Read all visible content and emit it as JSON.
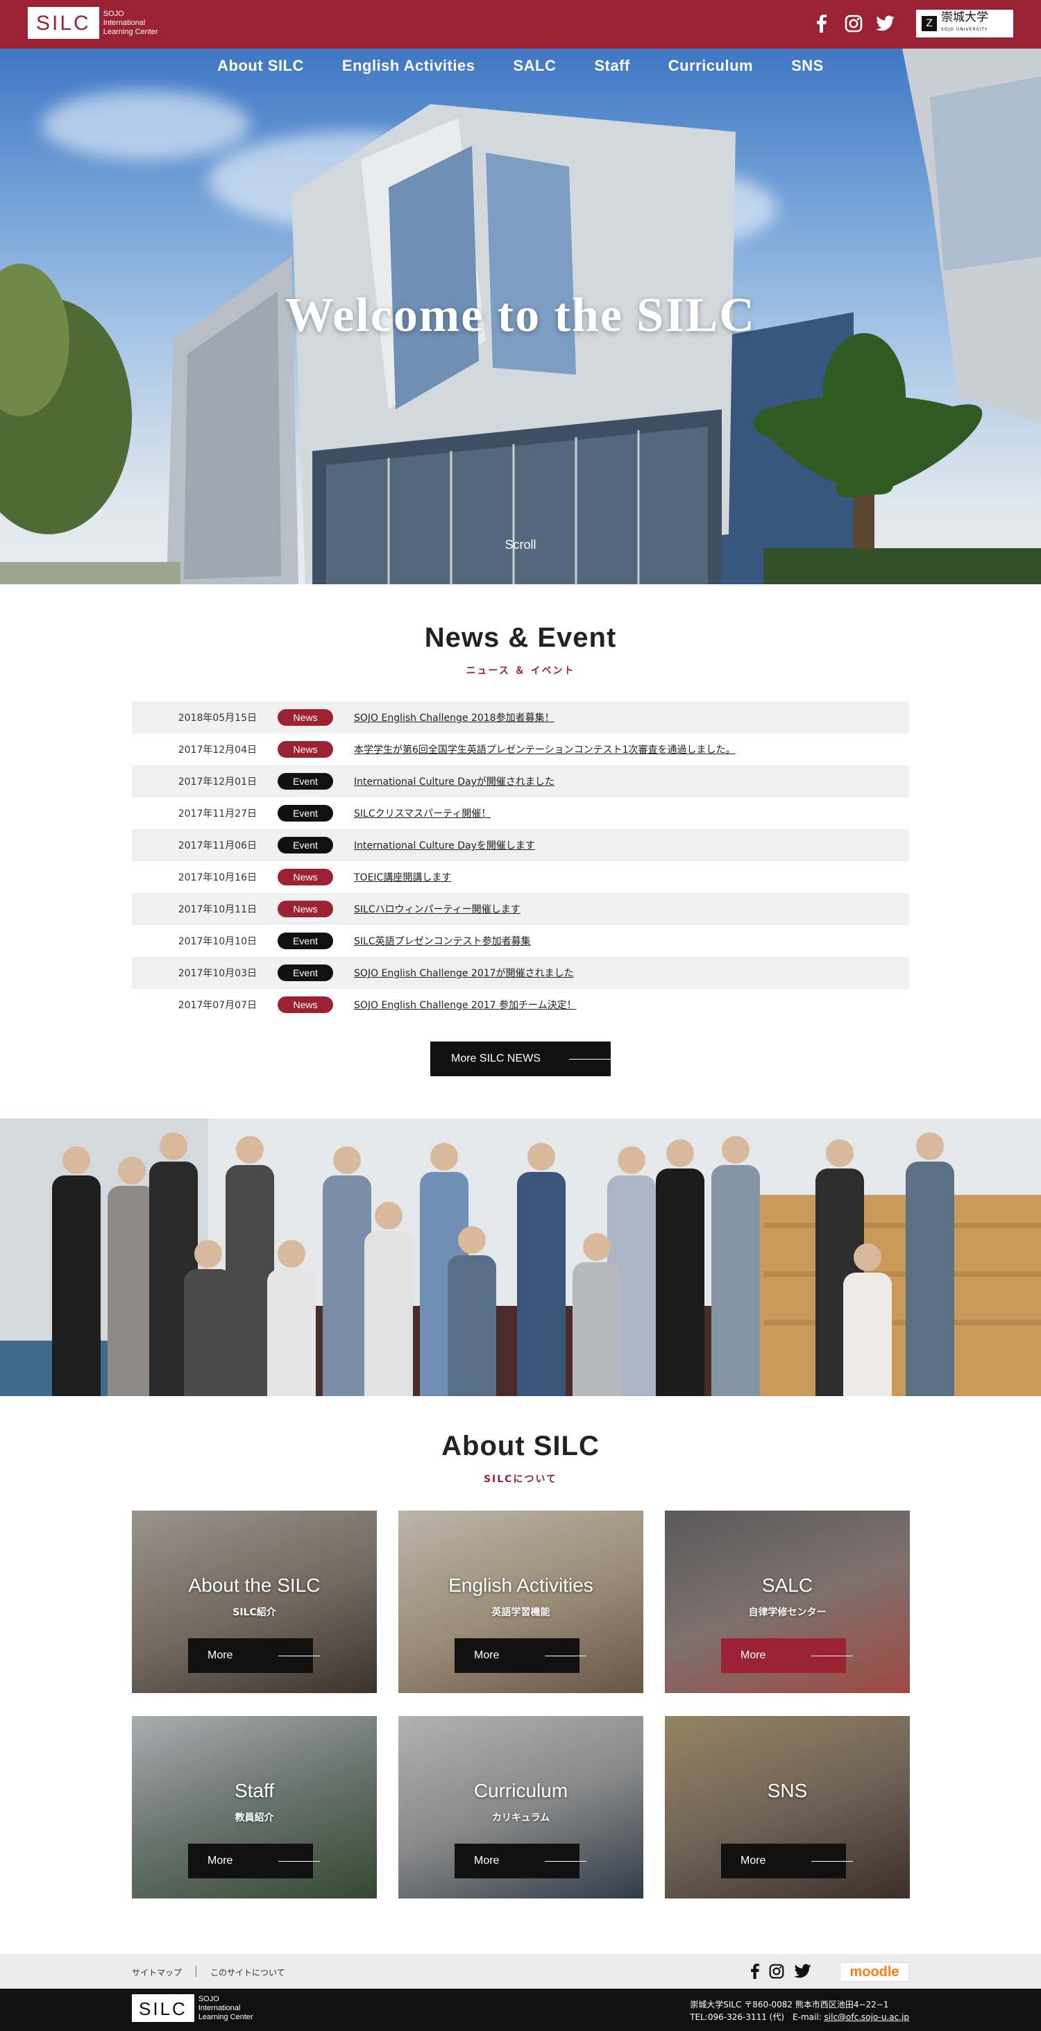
{
  "header": {
    "logo_text": "SILC",
    "logo_sub_1": "SOJO",
    "logo_sub_2": "International",
    "logo_sub_3": "Learning Center",
    "social_icons": [
      "facebook-icon",
      "instagram-icon",
      "twitter-icon"
    ],
    "university_logo_text": "崇城大学",
    "university_logo_sub": "SOJO UNIVERSITY",
    "brand_color": "#9b2232"
  },
  "nav": {
    "items": [
      "About SILC",
      "English Activities",
      "SALC",
      "Staff",
      "Curriculum",
      "SNS"
    ]
  },
  "hero": {
    "title": "Welcome to the SILC",
    "scroll_label": "Scroll"
  },
  "news": {
    "title": "News & Event",
    "subtitle": "ニュース ＆ イベント",
    "items": [
      {
        "date": "2018年05月15日",
        "type": "News",
        "title": "SOJO English Challenge 2018参加者募集！"
      },
      {
        "date": "2017年12月04日",
        "type": "News",
        "title": "本学学生が第6回全国学生英語プレゼンテーションコンテスト1次審査を通過しました。"
      },
      {
        "date": "2017年12月01日",
        "type": "Event",
        "title": "International Culture Dayが開催されました"
      },
      {
        "date": "2017年11月27日",
        "type": "Event",
        "title": "SILCクリスマスパーティ開催！"
      },
      {
        "date": "2017年11月06日",
        "type": "Event",
        "title": "International Culture Dayを開催します"
      },
      {
        "date": "2017年10月16日",
        "type": "News",
        "title": "TOEIC講座開講します"
      },
      {
        "date": "2017年10月11日",
        "type": "News",
        "title": "SILCハロウィンパーティー開催します"
      },
      {
        "date": "2017年10月10日",
        "type": "Event",
        "title": "SILC英語プレゼンコンテスト参加者募集"
      },
      {
        "date": "2017年10月03日",
        "type": "Event",
        "title": "SOJO English Challenge 2017が開催されました"
      },
      {
        "date": "2017年07月07日",
        "type": "News",
        "title": "SOJO English Challenge 2017 参加チーム決定！"
      }
    ],
    "more_label": "More SILC NEWS"
  },
  "about": {
    "title": "About SILC",
    "subtitle": "SILCについて",
    "cards": [
      {
        "title": "About the SILC",
        "sub": "SILC紹介",
        "more": "More",
        "active": false
      },
      {
        "title": "English Activities",
        "sub": "英語学習機能",
        "more": "More",
        "active": false
      },
      {
        "title": "SALC",
        "sub": "自律学修センター",
        "more": "More",
        "active": true
      },
      {
        "title": "Staff",
        "sub": "教員紹介",
        "more": "More",
        "active": false
      },
      {
        "title": "Curriculum",
        "sub": "カリキュラム",
        "more": "More",
        "active": false
      },
      {
        "title": "SNS",
        "sub": "",
        "more": "More",
        "active": false
      }
    ]
  },
  "footer": {
    "link_sitemap": "サイトマップ",
    "link_about_site": "このサイトについて",
    "moodle_label": "moodle",
    "address_line": "崇城大学SILC 〒860-0082 熊本市西区池田4−22−1",
    "tel_line": "TEL:096-326-3111 (代)　E-mail: ",
    "email": "silc@ofc.sojo-u.ac.jp"
  }
}
